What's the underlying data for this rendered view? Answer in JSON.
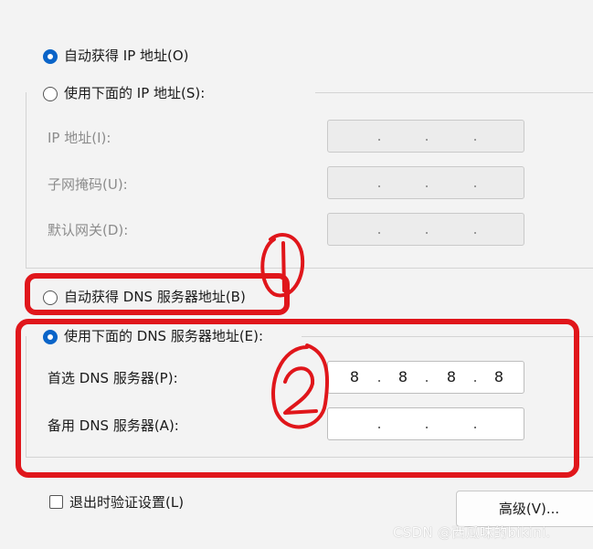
{
  "ip_section": {
    "auto_ip_label": "自动获得 IP 地址(O)",
    "manual_ip_label": "使用下面的 IP 地址(S):",
    "ip_address_label": "IP 地址(I):",
    "subnet_label": "子网掩码(U):",
    "gateway_label": "默认网关(D):"
  },
  "dns_section": {
    "auto_dns_label": "自动获得 DNS 服务器地址(B)",
    "manual_dns_label": "使用下面的 DNS 服务器地址(E):",
    "preferred_label": "首选 DNS 服务器(P):",
    "alternate_label": "备用 DNS 服务器(A):",
    "preferred_value": [
      "8",
      "8",
      "8",
      "8"
    ],
    "alternate_value": [
      "",
      "",
      "",
      ""
    ]
  },
  "footer": {
    "validate_label": "退出时验证设置(L)",
    "advanced_button": "高级(V)..."
  },
  "selection": {
    "ip_mode": "auto",
    "dns_mode": "manual",
    "validate_checked": false
  },
  "annotations": {
    "mark_1": "1",
    "mark_2": "2",
    "color": "#e0161b"
  },
  "watermark": "CSDN @西瓜味的bikini."
}
